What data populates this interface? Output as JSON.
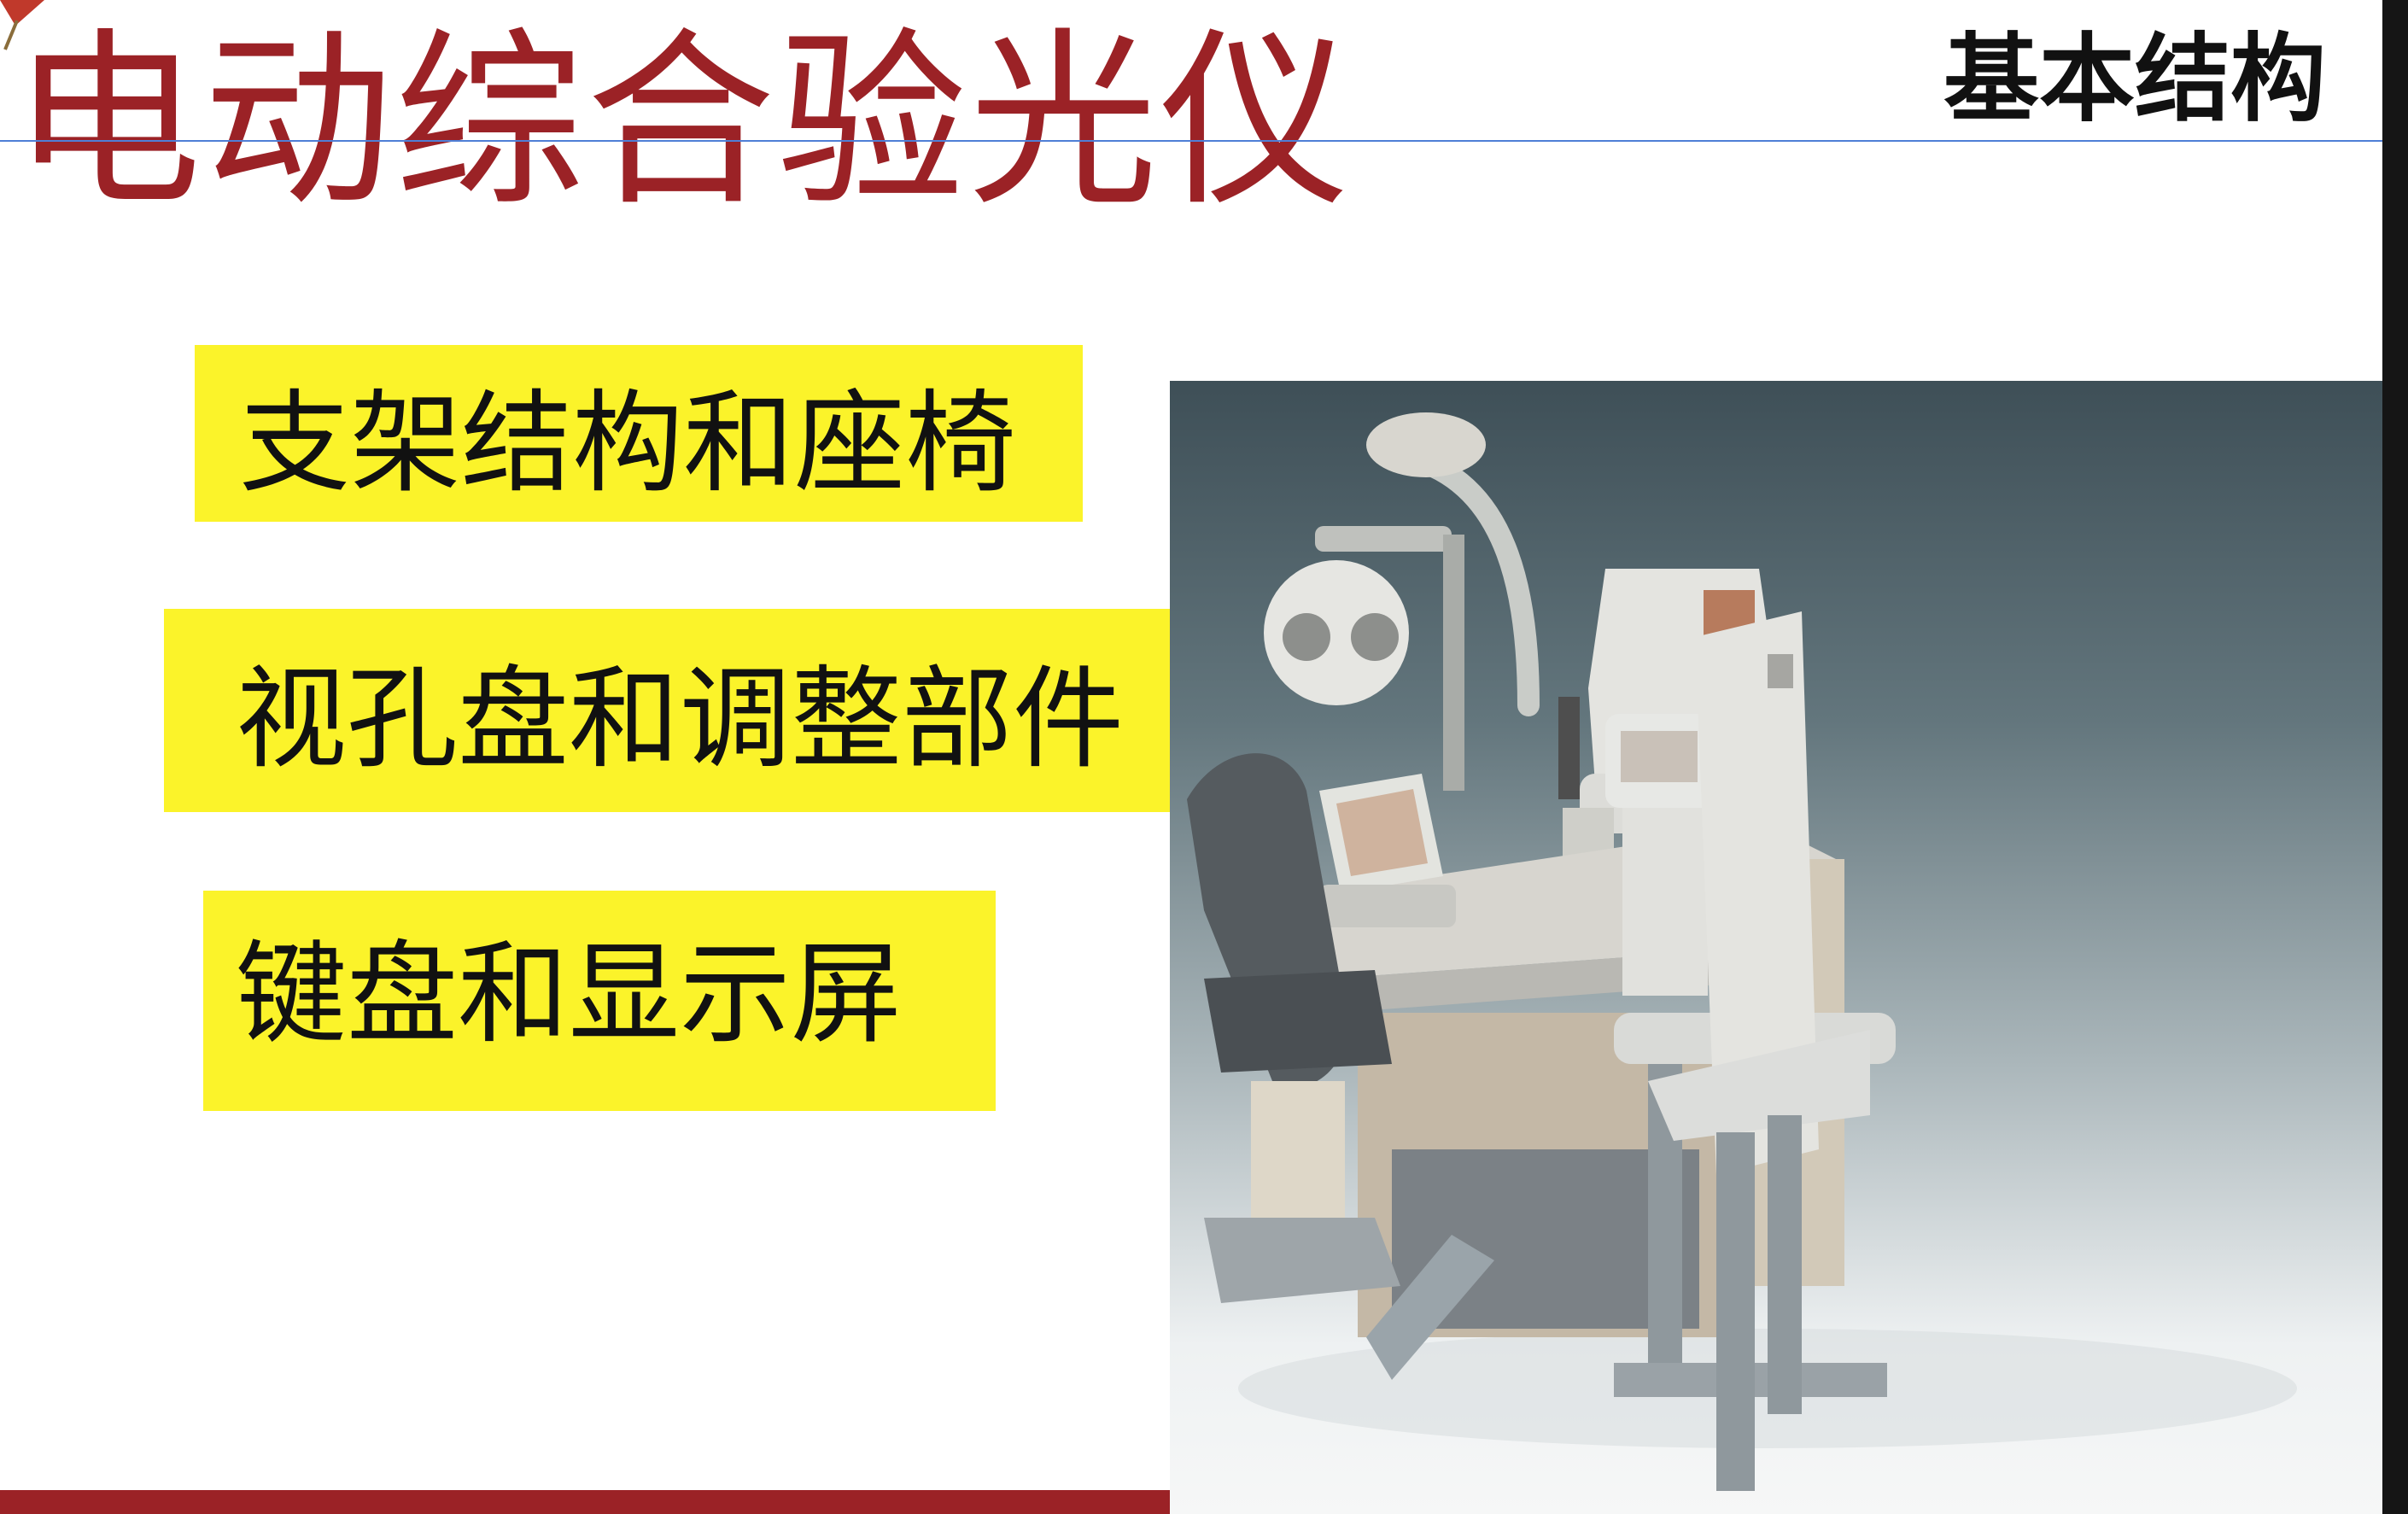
{
  "slide": {
    "title": "电动综合验光仪",
    "section_heading": "基本结构",
    "bullets": [
      {
        "label": "支架结构和座椅"
      },
      {
        "label": "视孔盘和调整部件"
      },
      {
        "label": "键盘和显示屏"
      }
    ],
    "photo": {
      "icon": "phoropter-workstation-photo"
    },
    "colors": {
      "title": "#9b2226",
      "highlight": "#fbf32a",
      "rule": "#4f7fd6",
      "footer_bar": "#9b2226"
    }
  }
}
